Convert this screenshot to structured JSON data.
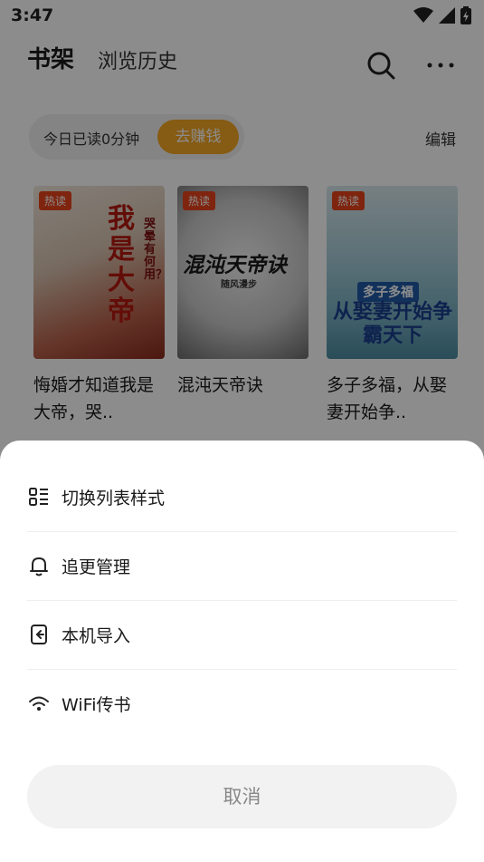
{
  "status_bar": {
    "time": "3:47"
  },
  "header": {
    "tab_shelf": "书架",
    "tab_history": "浏览历史"
  },
  "reading": {
    "today_read": "今日已读0分钟",
    "earn_label": "去赚钱",
    "edit_label": "编辑"
  },
  "books": [
    {
      "badge": "热读",
      "cover_title": "我是大帝",
      "cover_sub": "哭晕有何用？",
      "title": "悔婚才知道我是大帝，哭.."
    },
    {
      "badge": "热读",
      "cover_title": "混沌天帝诀",
      "cover_sub": "随风漫步",
      "title": "混沌天帝诀"
    },
    {
      "badge": "热读",
      "cover_title": "从娶妻开始争霸天下",
      "cover_sub": "多子多福",
      "title": "多子多福，从娶妻开始争.."
    }
  ],
  "sheet": {
    "items": [
      {
        "label": "切换列表样式",
        "icon": "list-style-icon"
      },
      {
        "label": "追更管理",
        "icon": "bell-icon"
      },
      {
        "label": "本机导入",
        "icon": "import-icon"
      },
      {
        "label": "WiFi传书",
        "icon": "wifi-icon"
      }
    ],
    "cancel_label": "取消"
  },
  "colors": {
    "accent": "#f5a623",
    "badge": "#e8441c",
    "overlay": "rgba(0,0,0,0.45)"
  }
}
